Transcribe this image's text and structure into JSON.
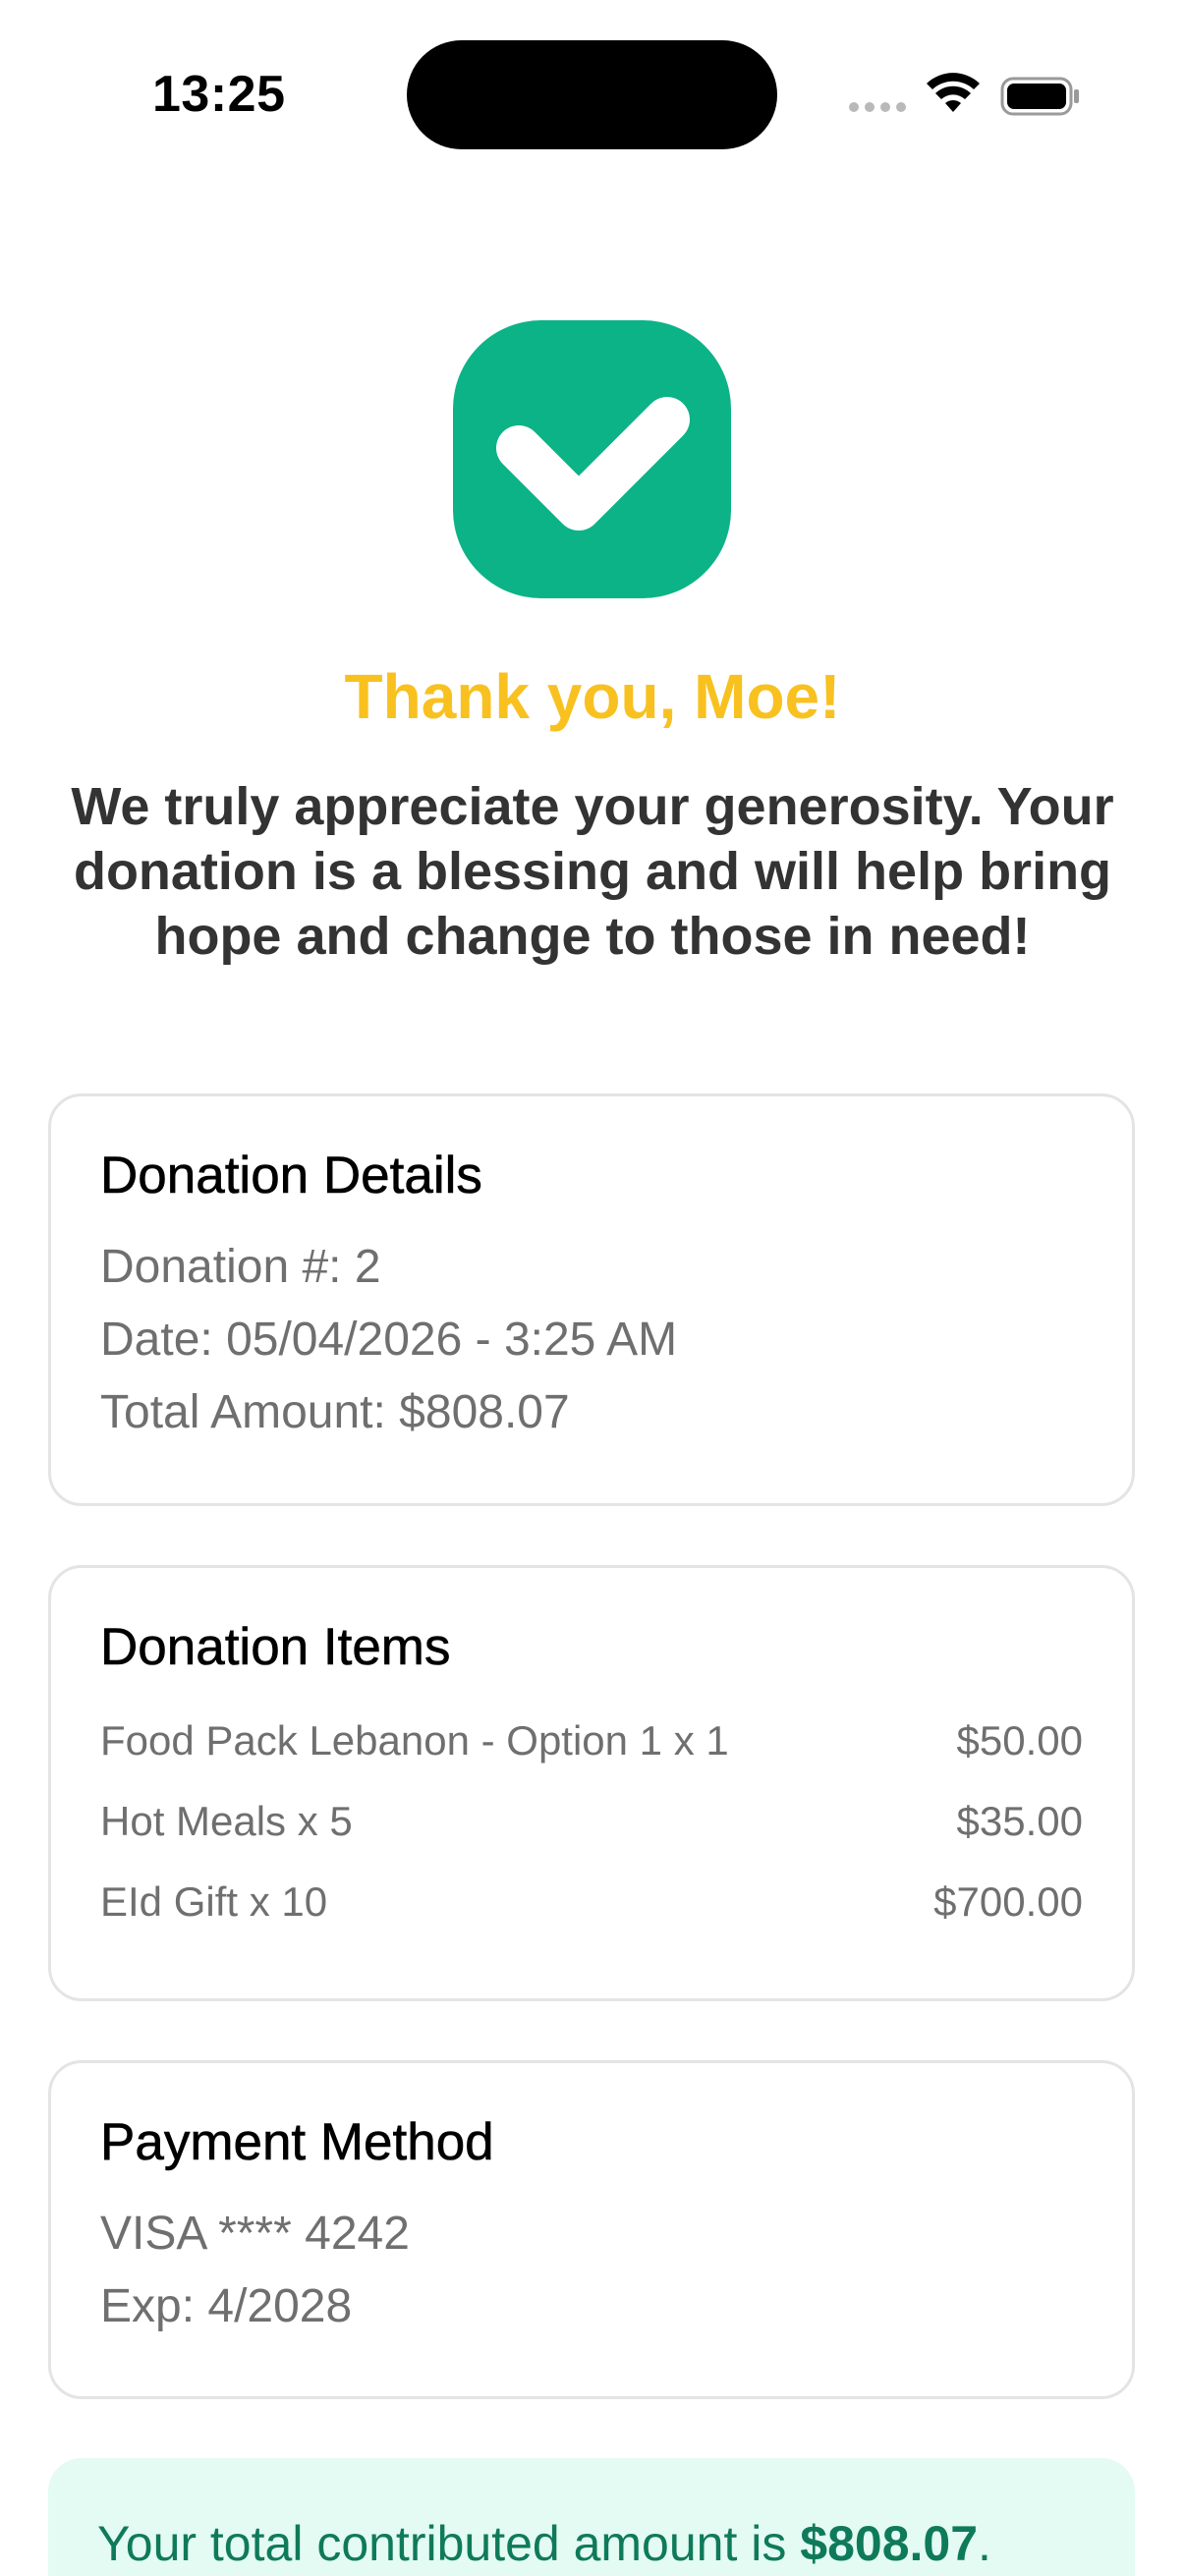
{
  "status_bar": {
    "time": "13:25"
  },
  "icons": {
    "success": "checkmark-icon",
    "wifi": "wifi-icon",
    "battery": "battery-icon",
    "signal": "cellular-signal-icon"
  },
  "colors": {
    "success_green": "#0bb387",
    "title_yellow": "#f8c120",
    "banner_bg": "#e3fbf2",
    "banner_text": "#0f7a5a"
  },
  "thanks": {
    "title": "Thank you, Moe!",
    "message": "We truly appreciate your generosity. Your donation is a blessing and will help bring hope and change to those in need!"
  },
  "donation_details": {
    "title": "Donation Details",
    "number": "Donation #: 2",
    "date": "Date: 05/04/2026 - 3:25 AM",
    "total": "Total Amount: $808.07"
  },
  "donation_items": {
    "title": "Donation Items",
    "items": [
      {
        "name": "Food Pack Lebanon - Option 1 x 1",
        "price": "$50.00"
      },
      {
        "name": "Hot Meals x 5",
        "price": "$35.00"
      },
      {
        "name": "EId Gift x 10",
        "price": "$700.00"
      }
    ]
  },
  "payment_method": {
    "title": "Payment Method",
    "card": "VISA **** 4242",
    "exp": "Exp: 4/2028"
  },
  "total_banner": {
    "prefix": "Your total contributed amount is ",
    "amount": "$808.07",
    "suffix": "."
  }
}
